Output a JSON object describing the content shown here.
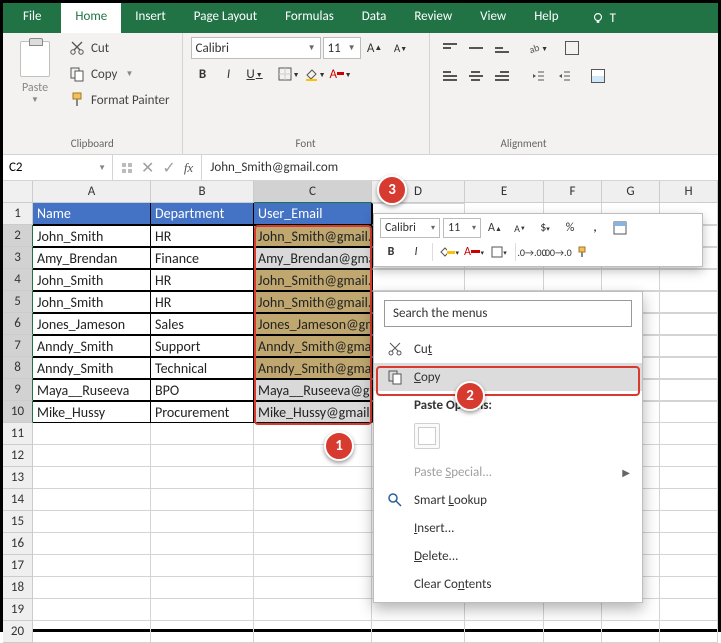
{
  "tabs": {
    "file": "File",
    "home": "Home",
    "insert": "Insert",
    "pageLayout": "Page Layout",
    "formulas": "Formulas",
    "data": "Data",
    "review": "Review",
    "view": "View",
    "help": "Help",
    "tell": "T"
  },
  "clipboard": {
    "cut": "Cut",
    "copy": "Copy",
    "formatPainter": "Format Painter",
    "paste": "Paste",
    "groupLabel": "Clipboard"
  },
  "font": {
    "name": "Calibri",
    "size": "11",
    "groupLabel": "Font"
  },
  "alignment": {
    "groupLabel": "Alignment"
  },
  "namebox": "C2",
  "formula": "John_Smith@gmail.com",
  "columns": [
    "A",
    "B",
    "C",
    "D",
    "E",
    "F",
    "G",
    "H"
  ],
  "headers": {
    "A": "Name",
    "B": "Department",
    "C": "User_Email"
  },
  "rows": [
    {
      "n": 2,
      "A": "John_Smith",
      "B": "HR",
      "C": "John_Smith@gmail.com",
      "odd": true
    },
    {
      "n": 3,
      "A": "Amy_Brendan",
      "B": "Finance",
      "C": "Amy_Brendan@gmail.com",
      "odd": false
    },
    {
      "n": 4,
      "A": "John_Smith",
      "B": "HR",
      "C": "John_Smith@gmail.com",
      "odd": true
    },
    {
      "n": 5,
      "A": "John_Smith",
      "B": "HR",
      "C": "John_Smith@gmail.com",
      "odd": true
    },
    {
      "n": 6,
      "A": "Jones_Jameson",
      "B": "Sales",
      "C": "Jones_Jameson@gmail.com",
      "odd": true
    },
    {
      "n": 7,
      "A": "Anndy_Smith",
      "B": "Support",
      "C": "Anndy_Smith@gmail.com",
      "odd": true
    },
    {
      "n": 8,
      "A": "Anndy_Smith",
      "B": "Technical",
      "C": "Anndy_Smith@gmail.com",
      "odd": true
    },
    {
      "n": 9,
      "A": "Maya__Ruseeva",
      "B": "BPO",
      "C": "Maya__Ruseeva@gmail.com",
      "odd": false
    },
    {
      "n": 10,
      "A": "Mike_Hussy",
      "B": "Procurement",
      "C": "Mike_Hussy@gmail.com",
      "odd": false
    }
  ],
  "emptyRows": [
    11,
    12,
    13,
    14,
    15,
    16,
    17,
    18,
    19,
    20
  ],
  "mini": {
    "font": "Calibri",
    "size": "11"
  },
  "ctx": {
    "search": "Search the menus",
    "cut": "Cut",
    "copy": "Copy",
    "pasteOptions": "Paste Options:",
    "pasteSpecial": "Paste Special...",
    "smartLookup": "Smart Lookup",
    "insert": "Insert...",
    "delete": "Delete...",
    "clear": "Clear Contents"
  },
  "callouts": {
    "c1": "1",
    "c2": "2",
    "c3": "3"
  }
}
